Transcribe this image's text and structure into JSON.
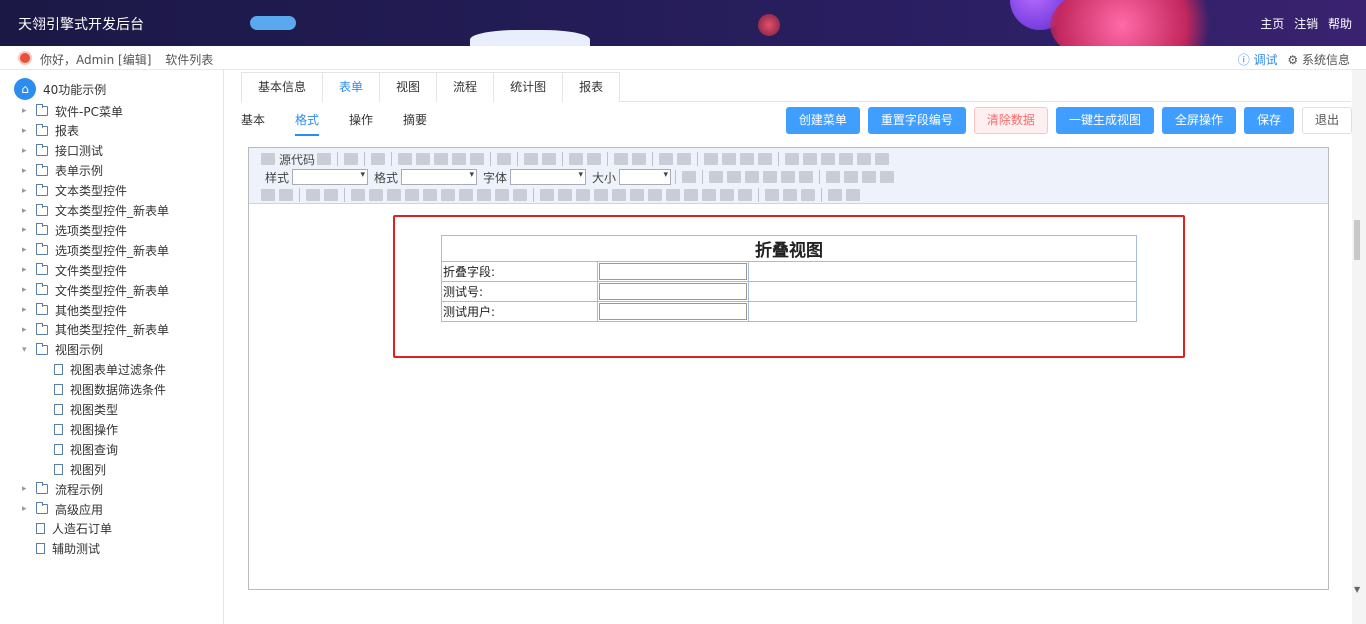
{
  "header": {
    "brand": "天翎引擎式开发后台",
    "nav": [
      "主页",
      "注销",
      "帮助"
    ]
  },
  "subbar": {
    "greeting": "你好，Admin [编辑]",
    "software_list": "软件列表",
    "debug": "ⓘ 调试",
    "system_info": "⚙ 系统信息"
  },
  "sidebar": {
    "root": "40功能示例",
    "items": [
      {
        "label": "软件-PC菜单",
        "type": "folder",
        "level": 1
      },
      {
        "label": "报表",
        "type": "folder",
        "level": 1
      },
      {
        "label": "接口测试",
        "type": "folder",
        "level": 1
      },
      {
        "label": "表单示例",
        "type": "folder",
        "level": 1
      },
      {
        "label": "文本类型控件",
        "type": "folder",
        "level": 1
      },
      {
        "label": "文本类型控件_新表单",
        "type": "folder",
        "level": 1
      },
      {
        "label": "选项类型控件",
        "type": "folder",
        "level": 1
      },
      {
        "label": "选项类型控件_新表单",
        "type": "folder",
        "level": 1
      },
      {
        "label": "文件类型控件",
        "type": "folder",
        "level": 1
      },
      {
        "label": "文件类型控件_新表单",
        "type": "folder",
        "level": 1
      },
      {
        "label": "其他类型控件",
        "type": "folder",
        "level": 1
      },
      {
        "label": "其他类型控件_新表单",
        "type": "folder",
        "level": 1
      },
      {
        "label": "视图示例",
        "type": "folder-open",
        "level": 1
      },
      {
        "label": "视图表单过滤条件",
        "type": "doc",
        "level": 2
      },
      {
        "label": "视图数据筛选条件",
        "type": "doc",
        "level": 2
      },
      {
        "label": "视图类型",
        "type": "doc",
        "level": 2
      },
      {
        "label": "视图操作",
        "type": "doc",
        "level": 2
      },
      {
        "label": "视图查询",
        "type": "doc",
        "level": 2
      },
      {
        "label": "视图列",
        "type": "doc",
        "level": 2
      },
      {
        "label": "流程示例",
        "type": "folder",
        "level": 1
      },
      {
        "label": "高级应用",
        "type": "folder",
        "level": 1
      },
      {
        "label": "人造石订单",
        "type": "doc",
        "level": 1
      },
      {
        "label": "辅助测试",
        "type": "doc",
        "level": 1
      }
    ]
  },
  "tabs": [
    "基本信息",
    "表单",
    "视图",
    "流程",
    "统计图",
    "报表"
  ],
  "active_tab": "表单",
  "subtabs": [
    "基本",
    "格式",
    "操作",
    "摘要"
  ],
  "active_subtab": "格式",
  "buttons": [
    "创建菜单",
    "重置字段编号",
    "清除数据",
    "一键生成视图",
    "全屏操作",
    "保存",
    "退出"
  ],
  "toolbar": {
    "source": "源代码",
    "style_label": "样式",
    "format_label": "格式",
    "font_label": "字体",
    "size_label": "大小"
  },
  "form": {
    "title": "折叠视图",
    "fields": [
      "折叠字段:",
      "测试号:",
      "测试用户:"
    ]
  }
}
